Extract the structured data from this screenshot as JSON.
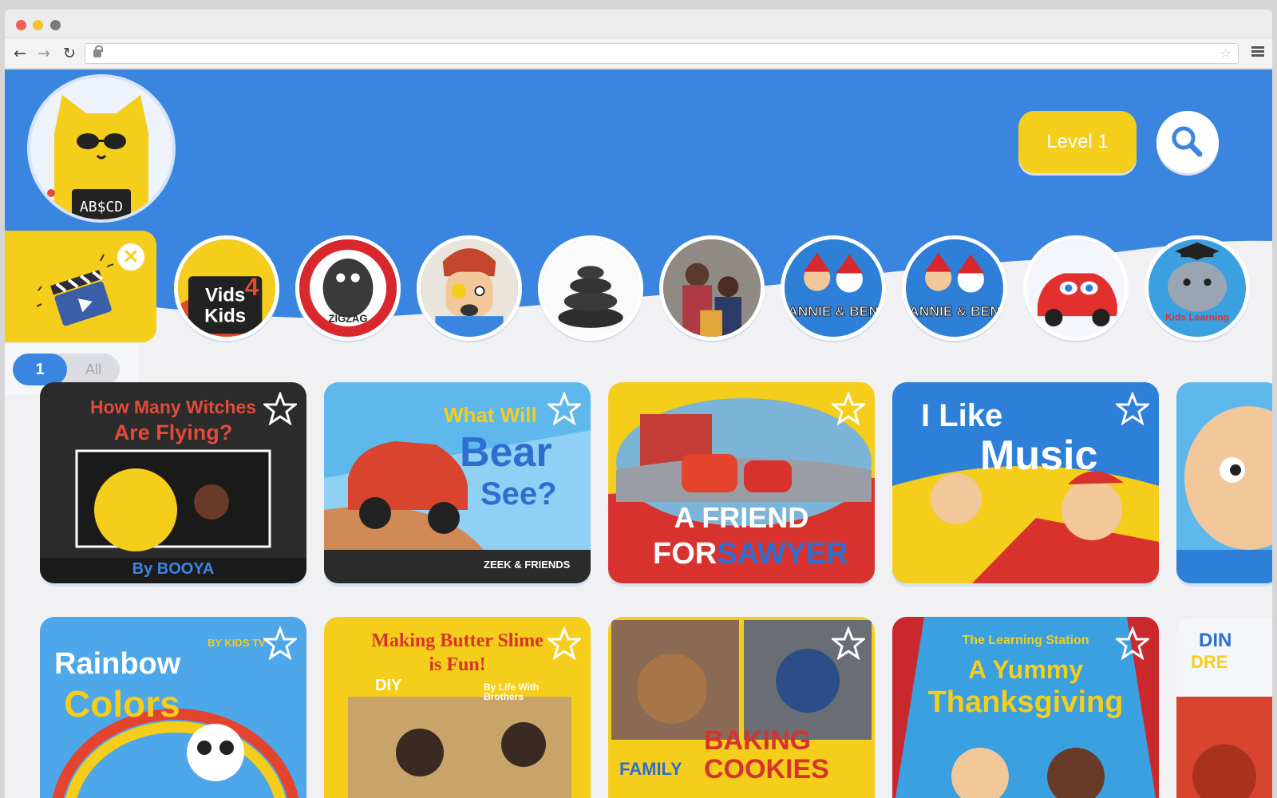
{
  "header": {
    "level_label": "Level 1",
    "avatar_shirt_text": "AB$CD"
  },
  "filter": {
    "option_one": "1",
    "option_all": "All"
  },
  "channels": [
    {
      "name": "vids-4-kids",
      "label": "Vids 4 Kids"
    },
    {
      "name": "zigzag",
      "label": "ZIGZAG"
    },
    {
      "name": "cartoon-guy",
      "label": ""
    },
    {
      "name": "stones",
      "label": ""
    },
    {
      "name": "family-photo",
      "label": ""
    },
    {
      "name": "annie-ben-1",
      "label": "ANNIE & BEN"
    },
    {
      "name": "annie-ben-2",
      "label": "ANNIE & BEN"
    },
    {
      "name": "red-car",
      "label": ""
    },
    {
      "name": "kids-learning-videos",
      "label": "Kids Learning Videos"
    }
  ],
  "videos_row1": [
    {
      "title_1": "How Many Witches",
      "title_2": "Are Flying?",
      "brand": "By BOOYA"
    },
    {
      "title_1": "What Will",
      "title_2": "Bear",
      "title_3": "See?",
      "brand": "ZEEK & FRIENDS"
    },
    {
      "title_1": "A FRIEND",
      "title_2": "FOR",
      "title_3": "SAWYER"
    },
    {
      "title_1": "I Like",
      "title_2": "Music"
    }
  ],
  "videos_row2": [
    {
      "title_1": "Rainbow",
      "title_2": "Colors",
      "brand": "BY KIDS TV"
    },
    {
      "title_1": "Making Butter Slime",
      "title_2": "is Fun!",
      "brand": "By Life With Brothers",
      "badge": "DIY"
    },
    {
      "title_1": "BAKING",
      "title_2": "COOKIES",
      "brand": "FAMILY"
    },
    {
      "title_1": "The Learning Station",
      "title_2": "A Yummy",
      "title_3": "Thanksgiving"
    },
    {
      "title_1": "DIN",
      "title_2": "DRE"
    }
  ],
  "colors": {
    "brand_blue": "#3a85e0",
    "brand_yellow": "#f5cd1b",
    "page_bg": "#f1f1f3"
  }
}
